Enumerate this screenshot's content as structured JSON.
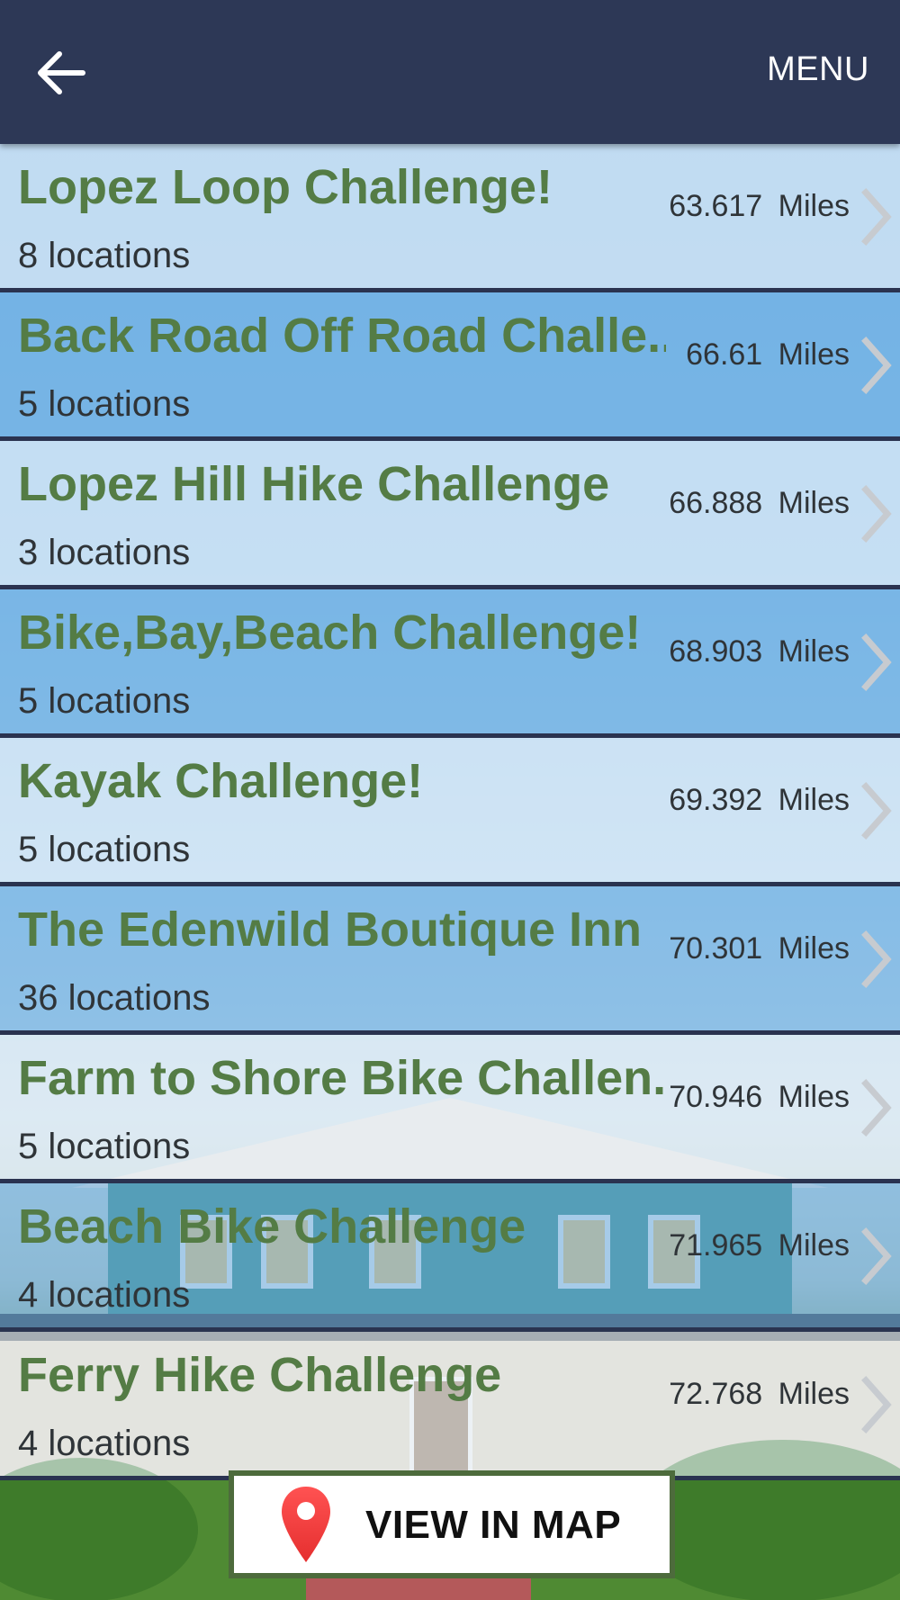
{
  "header": {
    "back_icon": "arrow-left-icon",
    "menu_label": "MENU",
    "background": "#2d3856"
  },
  "challenges": [
    {
      "title": "Lopez Loop Challenge!",
      "locations": "8 locations",
      "distance": "63.617 Miles",
      "shade": "light"
    },
    {
      "title": "Back Road Off Road Challe..",
      "locations": "5 locations",
      "distance": "66.61 Miles",
      "shade": "dark"
    },
    {
      "title": "Lopez Hill Hike Challenge",
      "locations": "3 locations",
      "distance": "66.888 Miles",
      "shade": "light"
    },
    {
      "title": "Bike,Bay,Beach Challenge!",
      "locations": "5 locations",
      "distance": "68.903 Miles",
      "shade": "dark"
    },
    {
      "title": "Kayak Challenge!",
      "locations": "5 locations",
      "distance": "69.392 Miles",
      "shade": "light"
    },
    {
      "title": "The Edenwild Boutique Inn",
      "locations": "36 locations",
      "distance": "70.301 Miles",
      "shade": "dark"
    },
    {
      "title": "Farm to Shore Bike Challen..",
      "locations": "5 locations",
      "distance": "70.946 Miles",
      "shade": "light"
    },
    {
      "title": "Beach Bike Challenge",
      "locations": "4 locations",
      "distance": "71.965 Miles",
      "shade": "dark"
    },
    {
      "title": "Ferry Hike Challenge",
      "locations": "4 locations",
      "distance": "72.768 Miles",
      "shade": "light"
    }
  ],
  "row_chevron_icon": "chevron-right-icon",
  "map_button": {
    "label": "VIEW IN MAP",
    "icon": "map-pin-icon",
    "border_color": "#4d6b3c"
  },
  "colors": {
    "title_green": "#547c45",
    "row_divider": "#2a3350"
  }
}
